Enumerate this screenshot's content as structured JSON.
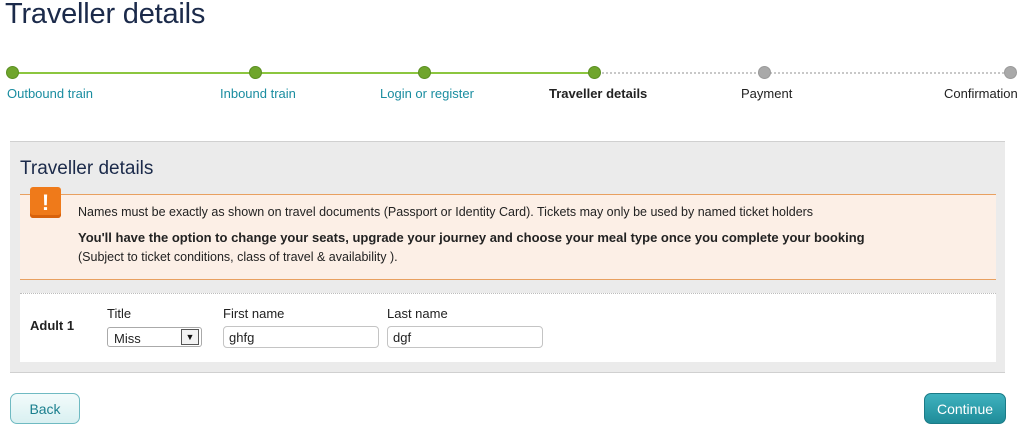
{
  "page": {
    "title": "Traveller details"
  },
  "progress": {
    "steps": [
      {
        "label": "Outbound train",
        "state": "done"
      },
      {
        "label": "Inbound train",
        "state": "done"
      },
      {
        "label": "Login or register",
        "state": "done"
      },
      {
        "label": "Traveller details",
        "state": "current"
      },
      {
        "label": "Payment",
        "state": "todo"
      },
      {
        "label": "Confirmation",
        "state": "todo"
      }
    ]
  },
  "panel": {
    "title": "Traveller details",
    "notice": {
      "icon": "warning-icon",
      "line1": "Names must be exactly as shown on travel documents (Passport or Identity Card). Tickets may only be used by named ticket holders",
      "line2": "You'll have the option to change your seats, upgrade your journey and choose your meal type once you complete your booking",
      "line3": "(Subject to ticket conditions, class of travel & availability )."
    },
    "traveller": {
      "label": "Adult 1",
      "title_label": "Title",
      "title_value": "Miss",
      "first_name_label": "First name",
      "first_name_value": "ghfg",
      "last_name_label": "Last name",
      "last_name_value": "dgf"
    }
  },
  "buttons": {
    "back": "Back",
    "continue": "Continue"
  },
  "colors": {
    "done": "#6fa52c",
    "todo": "#a9a9a9",
    "link": "#1a8da0",
    "accent": "#1f8c99",
    "warning": "#ef7a1a"
  }
}
